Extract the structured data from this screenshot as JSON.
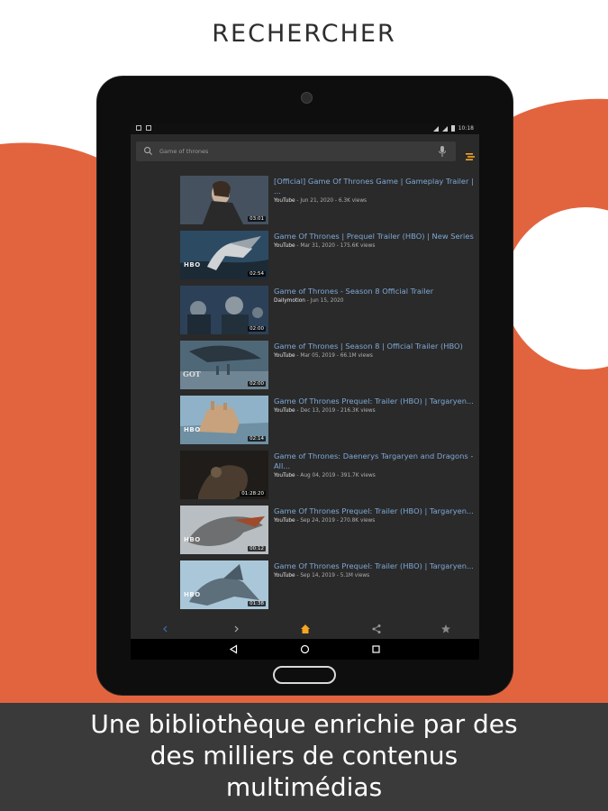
{
  "page": {
    "title": "RECHERCHER",
    "caption_lines": [
      "Une bibliothèque enrichie par des",
      "des milliers de contenus",
      "multimédias"
    ]
  },
  "colors": {
    "accent_orange": "#e2643f",
    "screen_bg": "#2a2a2a",
    "link_blue": "#7fa8d6",
    "nav_active": "#f5a623"
  },
  "status_bar": {
    "time": "10:18"
  },
  "search": {
    "value": "Game of thrones",
    "icons": [
      "search-icon",
      "mic-icon",
      "filter-icon"
    ]
  },
  "results": [
    {
      "title": "[Official] Game Of Thrones Game | Gameplay Trailer | ...",
      "source": "YouTube",
      "meta": " - Jun 21, 2020 - 6.3K views",
      "duration": "03:01",
      "badge": ""
    },
    {
      "title": "Game Of Thrones | Prequel Trailer (HBO) | New Series",
      "source": "YouTube",
      "meta": " - Mar 31, 2020 - 175.6K views",
      "duration": "02:54",
      "badge": "HBO"
    },
    {
      "title": "Game of Thrones - Season 8 Official Trailer",
      "source": "Dailymotion",
      "meta": " - Jun 15, 2020",
      "duration": "02:00",
      "badge": ""
    },
    {
      "title": "Game of Thrones | Season 8 | Official Trailer (HBO)",
      "source": "YouTube",
      "meta": " - Mar 05, 2019 - 66.1M views",
      "duration": "02:00",
      "badge": "GOT"
    },
    {
      "title": "Game Of Thrones Prequel: Trailer (HBO) | Targaryen...",
      "source": "YouTube",
      "meta": " - Dec 13, 2019 - 216.3K views",
      "duration": "02:14",
      "badge": "HBO"
    },
    {
      "title": "Game of Thrones: Daenerys Targaryen and Dragons - All...",
      "source": "YouTube",
      "meta": " - Aug 04, 2019 - 391.7K views",
      "duration": "01:28:20",
      "badge": ""
    },
    {
      "title": "Game Of Thrones Prequel: Trailer (HBO) | Targaryen...",
      "source": "YouTube",
      "meta": " - Sep 24, 2019 - 270.8K views",
      "duration": "00:12",
      "badge": "HBO"
    },
    {
      "title": "Game Of Thrones Prequel: Trailer (HBO) | Targaryen...",
      "source": "YouTube",
      "meta": " - Sep 14, 2019 - 5.1M views",
      "duration": "01:38",
      "badge": "HBO"
    }
  ],
  "bottom_nav": {
    "items": [
      "back-arrow-icon",
      "forward-arrow-icon",
      "home-icon",
      "share-icon",
      "star-icon"
    ],
    "active": "home-icon"
  },
  "system_nav": {
    "items": [
      "back-triangle-icon",
      "home-circle-icon",
      "recents-square-icon"
    ]
  }
}
